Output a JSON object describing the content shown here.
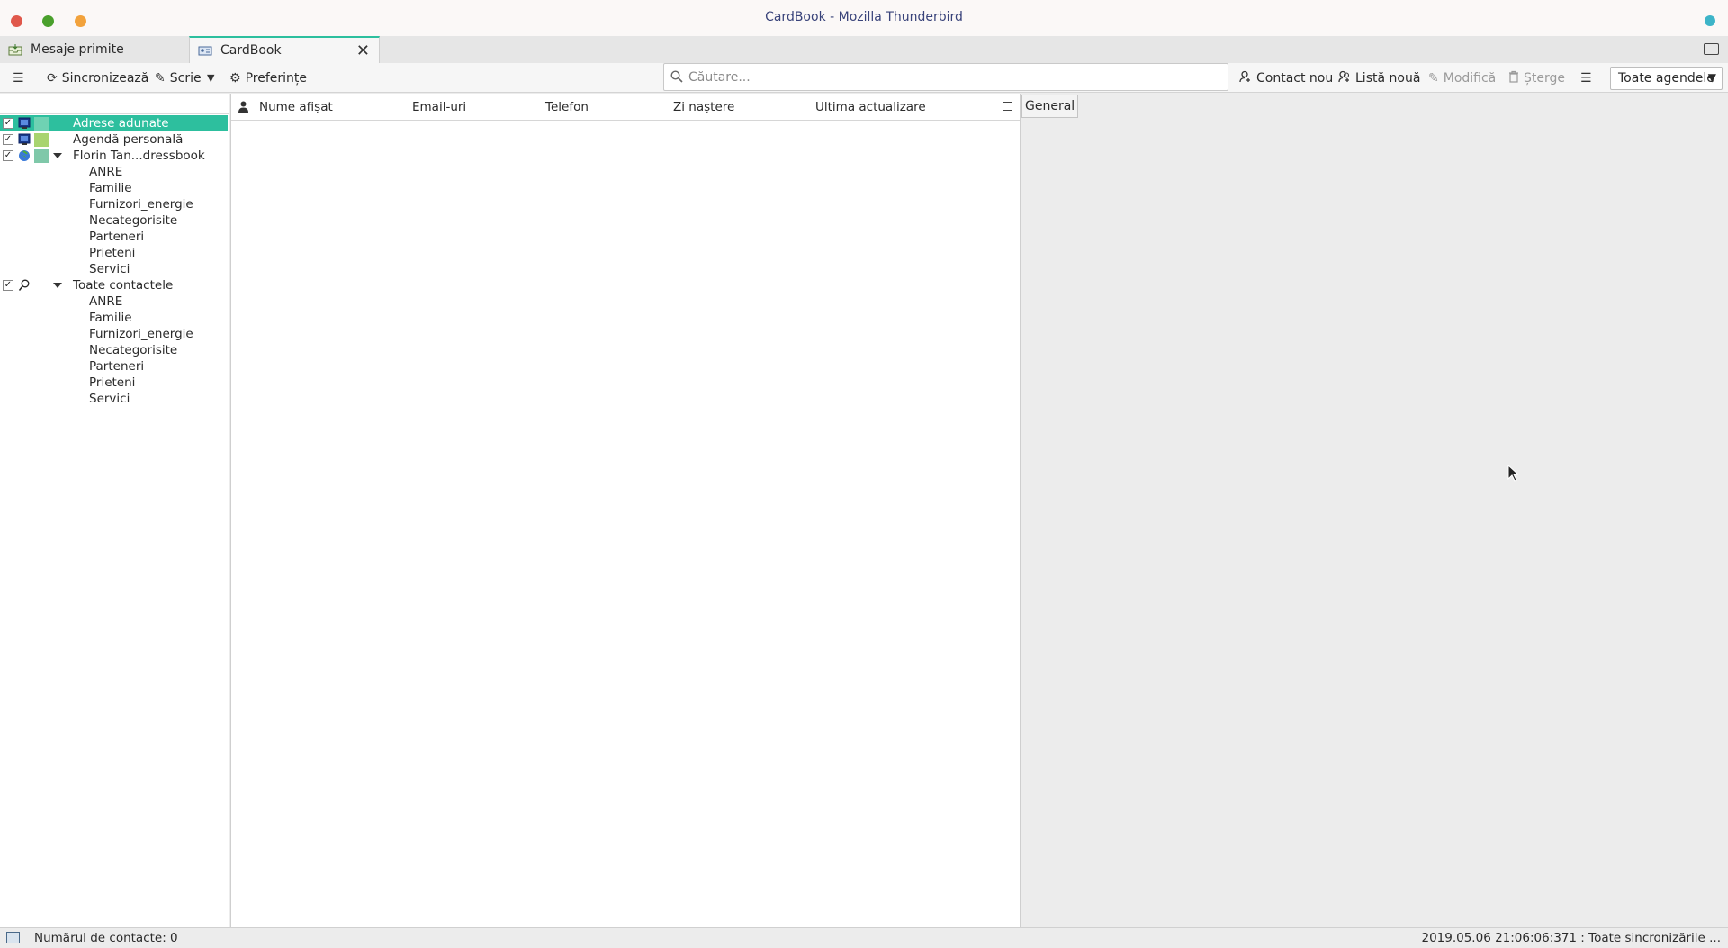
{
  "window": {
    "title": "CardBook - Mozilla Thunderbird",
    "colors": {
      "close": "#e0584b",
      "minimize": "#4aa02c",
      "maximize": "#f2a23c",
      "accent": "#2dbf9e"
    }
  },
  "tabs": [
    {
      "label": "Mesaje primite",
      "icon": "inbox-icon"
    },
    {
      "label": "CardBook",
      "icon": "cardbook-icon",
      "active": true
    }
  ],
  "toolbar": {
    "sync_label": "Sincronizează",
    "write_label": "Scrie",
    "prefs_label": "Preferințe",
    "new_contact_label": "Contact nou",
    "new_list_label": "Listă nouă",
    "edit_label": "Modifică",
    "delete_label": "Șterge",
    "addressbook_select": "Toate agendele"
  },
  "search": {
    "placeholder": "Căutare..."
  },
  "tree": {
    "items": [
      {
        "label": "Adrese adunate",
        "checked": true,
        "selected": true,
        "swatch": "#6fd2b3"
      },
      {
        "label": "Agendă personală",
        "checked": true,
        "swatch": "#a8d46f"
      },
      {
        "label": "Florin Tan...dressbook",
        "checked": true,
        "swatch": "#7fc8a9",
        "expanded": true,
        "children": [
          "ANRE",
          "Familie",
          "Furnizori_energie",
          "Necategorisite",
          "Parteneri",
          "Prieteni",
          "Servici"
        ]
      },
      {
        "label": "Toate contactele",
        "checked": true,
        "expanded": true,
        "children": [
          "ANRE",
          "Familie",
          "Furnizori_energie",
          "Necategorisite",
          "Parteneri",
          "Prieteni",
          "Servici"
        ]
      }
    ]
  },
  "columns": [
    "Nume afișat",
    "Email-uri",
    "Telefon",
    "Zi naștere",
    "Ultima actualizare"
  ],
  "detail": {
    "tab_label": "General"
  },
  "status": {
    "count": "Numărul de contacte: 0",
    "sync": "2019.05.06 21:06:06:371 : Toate sincronizările ..."
  }
}
